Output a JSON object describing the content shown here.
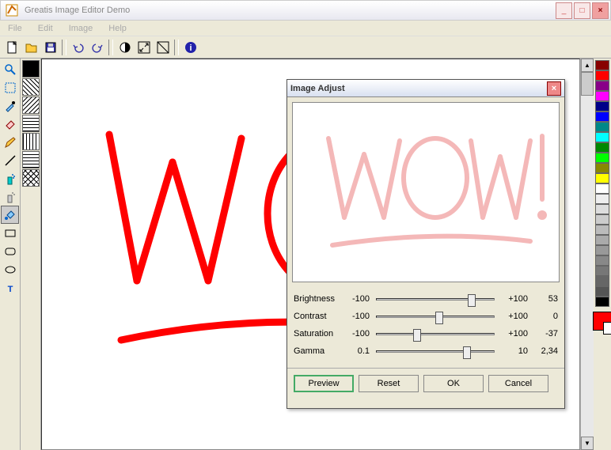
{
  "window": {
    "title": "Greatis Image Editor Demo"
  },
  "menu": [
    "File",
    "Edit",
    "Image",
    "Help"
  ],
  "dialog": {
    "title": "Image Adjust",
    "sliders": [
      {
        "label": "Brightness",
        "min": "-100",
        "max": "+100",
        "val": "53",
        "pos": 76
      },
      {
        "label": "Contrast",
        "min": "-100",
        "max": "+100",
        "val": "0",
        "pos": 50
      },
      {
        "label": "Saturation",
        "min": "-100",
        "max": "+100",
        "val": "-37",
        "pos": 32
      },
      {
        "label": "Gamma",
        "min": "0.1",
        "max": "10",
        "val": "2,34",
        "pos": 72
      }
    ],
    "buttons": {
      "preview": "Preview",
      "reset": "Reset",
      "ok": "OK",
      "cancel": "Cancel"
    }
  },
  "palette": [
    "#800",
    "#f00",
    "#808",
    "#f0f",
    "#008",
    "#00f",
    "#088",
    "#0ff",
    "#080",
    "#0f0",
    "#880",
    "#ff0",
    "#fff",
    "#eee",
    "#ddd",
    "#ccc",
    "#bbb",
    "#aaa",
    "#999",
    "#888",
    "#777",
    "#666",
    "#555",
    "#000"
  ]
}
